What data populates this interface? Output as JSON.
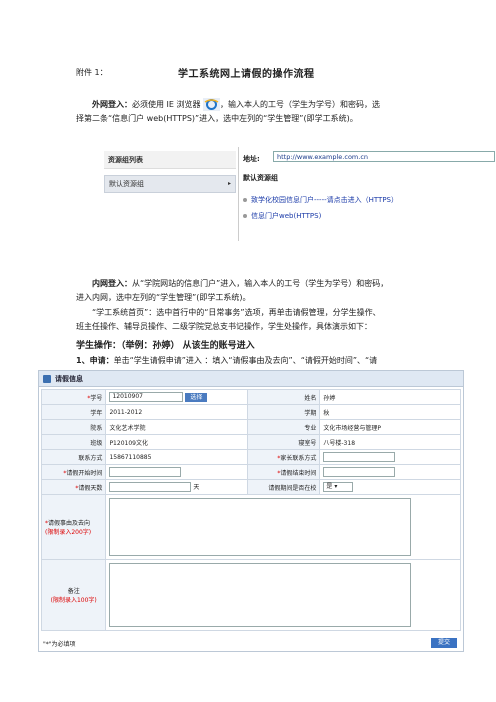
{
  "header": {
    "attachment": "附件 1：",
    "title": "学工系统网上请假的操作流程"
  },
  "external": {
    "label": "外网登入：",
    "line1_pre": "必须使用 IE 浏览器",
    "line1_post": "，输入本人的工号（学生为学号）和密码，选",
    "line2": "择第二条“信息门户 web(HTTPS)”进入，选中左列的“学生管理”(即学工系统)。"
  },
  "screenshot1": {
    "left_header": "资源组列表",
    "left_item": "默认资源组",
    "address_label": "地址:",
    "address": "http://www.example.com.cn",
    "group_title": "默认资源组",
    "links": [
      "致学化校园信息门户-----请点击进入（HTTPS）",
      "信息门户web(HTTPS)"
    ]
  },
  "internal": {
    "label": "内网登入：",
    "line1": "从“学院网站的信息门户”进入，输入本人的工号（学生为学号）和密码，",
    "line2": "进入内网，选中左列的“学生管理”(即学工系统)。"
  },
  "home": {
    "line1": "“学工系统首页”：选中首行中的“日常事务”选项，再单击请假管理，分学生操作、",
    "line2": "班主任操作、辅导员操作、二级学院党总支书记操作，学生处操作，具体演示如下："
  },
  "student": {
    "heading": "学生操作：（举例：孙婷）  从该生的账号进入"
  },
  "step1": {
    "num": "1、",
    "label": "申请：",
    "text": "单击“学生请假申请”进入 ：填入“请假事由及去向”、“请假开始时间”、“请"
  },
  "form": {
    "title": "请假信息",
    "rows": [
      [
        "学号",
        "12010907",
        "姓名",
        "孙婷"
      ],
      [
        "学年",
        "2011-2012",
        "学期",
        "秋"
      ],
      [
        "院系",
        "文化艺术学院",
        "专业",
        "文化市场经营与管理P"
      ],
      [
        "班级",
        "P120109文化",
        "寝室号",
        "八号楼-318"
      ],
      [
        "联系方式",
        "15867110885",
        "家长联系方式",
        ""
      ],
      [
        "请假开始时间",
        "",
        "请假结束时间",
        ""
      ],
      [
        "请假天数",
        "",
        "请假期间是否在校",
        ""
      ]
    ],
    "select_btn": "选择",
    "days_unit": "天",
    "yes_option": "是",
    "reason_label": "请假事由及去向",
    "reason_limit": "(限制录入200字)",
    "note_label": "备注",
    "note_limit": "(限制录入100字)",
    "footer_note": "\"*\"为必填项",
    "submit": "提交"
  },
  "colors": {
    "form_header": "#dfe8f3",
    "label_bg": "#eef3f9",
    "required": "#d00000",
    "button": "#3a72c2"
  }
}
